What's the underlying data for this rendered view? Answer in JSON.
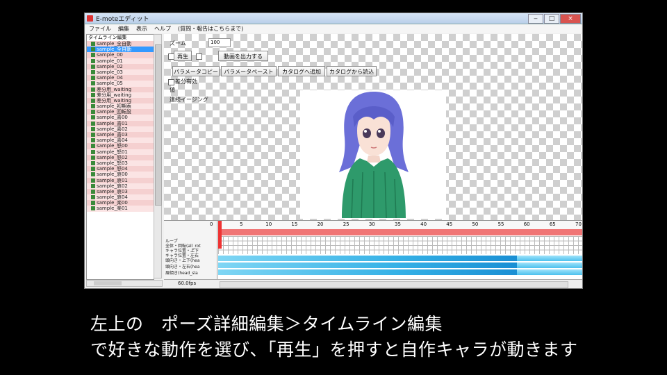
{
  "window": {
    "title": "E-moteエディット",
    "buttons": {
      "minimize": "‒",
      "maximize": "□",
      "close": "×"
    }
  },
  "menu": {
    "items": [
      "ファイル",
      "編集",
      "表示",
      "ヘルプ",
      "(質問・報告はこちらまで)"
    ]
  },
  "tree": {
    "root": "タイムライン編集",
    "items": [
      "sample_全自動",
      "sample_全自動",
      "sample_00",
      "sample_01",
      "sample_02",
      "sample_03",
      "sample_04",
      "sample_05",
      "差分用_waiting",
      "差分用_waiting",
      "差分用_waiting",
      "sample_初期表",
      "sample_回転設",
      "sample_喜00",
      "sample_喜01",
      "sample_喜02",
      "sample_喜03",
      "sample_喜04",
      "sample_怒00",
      "sample_怒01",
      "sample_怒02",
      "sample_怒03",
      "sample_怒04",
      "sample_哀00",
      "sample_哀01",
      "sample_哀02",
      "sample_哀03",
      "sample_哀04",
      "sample_楽00",
      "sample_楽01"
    ],
    "selected_index": 1
  },
  "toolbar": {
    "zoom_label": "ズーム",
    "zoom_value": "100",
    "play_button": "再生",
    "export_video_button": "動画を出力する",
    "param_copy_button": "パラメータコピー",
    "param_paste_button": "パラメータペースト",
    "catalog_add_button": "カタログへ追加",
    "catalog_load_button": "カタログから読込"
  },
  "options": [
    {
      "label": "差分有効"
    },
    {
      "label": "値"
    },
    {
      "label": "連続イージング"
    }
  ],
  "timeline": {
    "frame_ticks": [
      "0",
      "5",
      "10",
      "15",
      "20",
      "25",
      "30",
      "35",
      "40",
      "45",
      "50",
      "55",
      "60",
      "65",
      "70"
    ],
    "tracks": [
      "ループ",
      "全体・回転(all_rot",
      "キャラ位置・上下",
      "キャラ位置・左右",
      "頭向き・上下(hea",
      "頭向き・左右(hea",
      "眉傾き(head_sla"
    ],
    "playhead_frame": 0
  },
  "status": {
    "fps": "60.0fps"
  },
  "caption": {
    "line1": "左上の　ポーズ詳細編集＞タイムライン編集",
    "line2": "で好きな動作を選び、「再生」を押すと自作キャラが動きます"
  }
}
